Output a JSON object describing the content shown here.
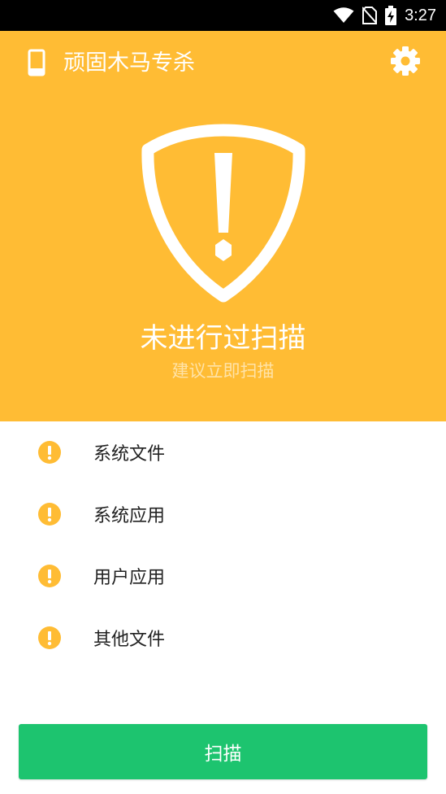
{
  "status_bar": {
    "time": "3:27",
    "icons": [
      "wifi-icon",
      "no-sim-icon",
      "battery-charging-icon"
    ]
  },
  "header": {
    "title": "顽固木马专杀",
    "left_icon": "phone-icon",
    "right_icon": "gear-icon"
  },
  "hero": {
    "icon": "shield-warning-icon",
    "status": "未进行过扫描",
    "hint": "建议立即扫描"
  },
  "items": [
    {
      "label": "系统文件",
      "icon": "warning-icon"
    },
    {
      "label": "系统应用",
      "icon": "warning-icon"
    },
    {
      "label": "用户应用",
      "icon": "warning-icon"
    },
    {
      "label": "其他文件",
      "icon": "warning-icon"
    }
  ],
  "actions": {
    "scan_label": "扫描"
  },
  "colors": {
    "accent": "#FFBC34",
    "primary": "#1DC46F",
    "status_bar": "#000000"
  }
}
